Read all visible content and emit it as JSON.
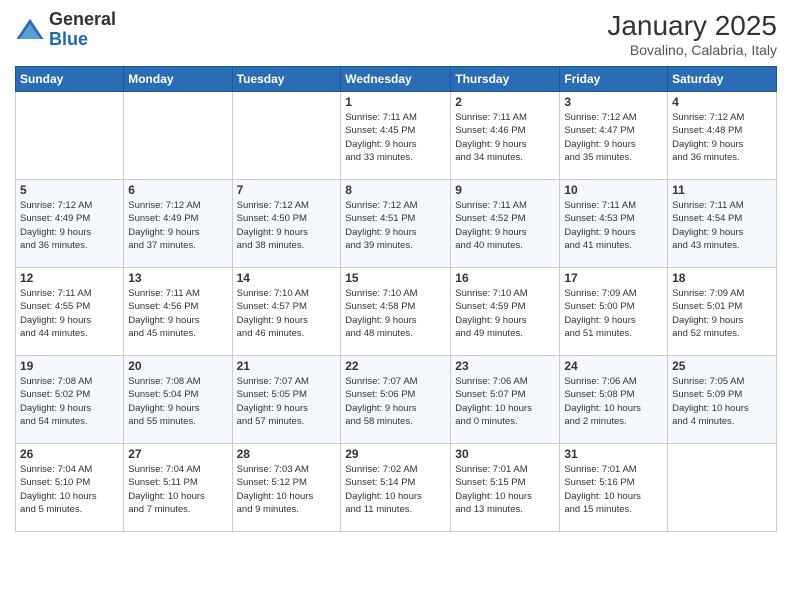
{
  "logo": {
    "general": "General",
    "blue": "Blue"
  },
  "header": {
    "month_year": "January 2025",
    "location": "Bovalino, Calabria, Italy"
  },
  "weekdays": [
    "Sunday",
    "Monday",
    "Tuesday",
    "Wednesday",
    "Thursday",
    "Friday",
    "Saturday"
  ],
  "weeks": [
    [
      {
        "day": "",
        "info": ""
      },
      {
        "day": "",
        "info": ""
      },
      {
        "day": "",
        "info": ""
      },
      {
        "day": "1",
        "info": "Sunrise: 7:11 AM\nSunset: 4:45 PM\nDaylight: 9 hours\nand 33 minutes."
      },
      {
        "day": "2",
        "info": "Sunrise: 7:11 AM\nSunset: 4:46 PM\nDaylight: 9 hours\nand 34 minutes."
      },
      {
        "day": "3",
        "info": "Sunrise: 7:12 AM\nSunset: 4:47 PM\nDaylight: 9 hours\nand 35 minutes."
      },
      {
        "day": "4",
        "info": "Sunrise: 7:12 AM\nSunset: 4:48 PM\nDaylight: 9 hours\nand 36 minutes."
      }
    ],
    [
      {
        "day": "5",
        "info": "Sunrise: 7:12 AM\nSunset: 4:49 PM\nDaylight: 9 hours\nand 36 minutes."
      },
      {
        "day": "6",
        "info": "Sunrise: 7:12 AM\nSunset: 4:49 PM\nDaylight: 9 hours\nand 37 minutes."
      },
      {
        "day": "7",
        "info": "Sunrise: 7:12 AM\nSunset: 4:50 PM\nDaylight: 9 hours\nand 38 minutes."
      },
      {
        "day": "8",
        "info": "Sunrise: 7:12 AM\nSunset: 4:51 PM\nDaylight: 9 hours\nand 39 minutes."
      },
      {
        "day": "9",
        "info": "Sunrise: 7:11 AM\nSunset: 4:52 PM\nDaylight: 9 hours\nand 40 minutes."
      },
      {
        "day": "10",
        "info": "Sunrise: 7:11 AM\nSunset: 4:53 PM\nDaylight: 9 hours\nand 41 minutes."
      },
      {
        "day": "11",
        "info": "Sunrise: 7:11 AM\nSunset: 4:54 PM\nDaylight: 9 hours\nand 43 minutes."
      }
    ],
    [
      {
        "day": "12",
        "info": "Sunrise: 7:11 AM\nSunset: 4:55 PM\nDaylight: 9 hours\nand 44 minutes."
      },
      {
        "day": "13",
        "info": "Sunrise: 7:11 AM\nSunset: 4:56 PM\nDaylight: 9 hours\nand 45 minutes."
      },
      {
        "day": "14",
        "info": "Sunrise: 7:10 AM\nSunset: 4:57 PM\nDaylight: 9 hours\nand 46 minutes."
      },
      {
        "day": "15",
        "info": "Sunrise: 7:10 AM\nSunset: 4:58 PM\nDaylight: 9 hours\nand 48 minutes."
      },
      {
        "day": "16",
        "info": "Sunrise: 7:10 AM\nSunset: 4:59 PM\nDaylight: 9 hours\nand 49 minutes."
      },
      {
        "day": "17",
        "info": "Sunrise: 7:09 AM\nSunset: 5:00 PM\nDaylight: 9 hours\nand 51 minutes."
      },
      {
        "day": "18",
        "info": "Sunrise: 7:09 AM\nSunset: 5:01 PM\nDaylight: 9 hours\nand 52 minutes."
      }
    ],
    [
      {
        "day": "19",
        "info": "Sunrise: 7:08 AM\nSunset: 5:02 PM\nDaylight: 9 hours\nand 54 minutes."
      },
      {
        "day": "20",
        "info": "Sunrise: 7:08 AM\nSunset: 5:04 PM\nDaylight: 9 hours\nand 55 minutes."
      },
      {
        "day": "21",
        "info": "Sunrise: 7:07 AM\nSunset: 5:05 PM\nDaylight: 9 hours\nand 57 minutes."
      },
      {
        "day": "22",
        "info": "Sunrise: 7:07 AM\nSunset: 5:06 PM\nDaylight: 9 hours\nand 58 minutes."
      },
      {
        "day": "23",
        "info": "Sunrise: 7:06 AM\nSunset: 5:07 PM\nDaylight: 10 hours\nand 0 minutes."
      },
      {
        "day": "24",
        "info": "Sunrise: 7:06 AM\nSunset: 5:08 PM\nDaylight: 10 hours\nand 2 minutes."
      },
      {
        "day": "25",
        "info": "Sunrise: 7:05 AM\nSunset: 5:09 PM\nDaylight: 10 hours\nand 4 minutes."
      }
    ],
    [
      {
        "day": "26",
        "info": "Sunrise: 7:04 AM\nSunset: 5:10 PM\nDaylight: 10 hours\nand 5 minutes."
      },
      {
        "day": "27",
        "info": "Sunrise: 7:04 AM\nSunset: 5:11 PM\nDaylight: 10 hours\nand 7 minutes."
      },
      {
        "day": "28",
        "info": "Sunrise: 7:03 AM\nSunset: 5:12 PM\nDaylight: 10 hours\nand 9 minutes."
      },
      {
        "day": "29",
        "info": "Sunrise: 7:02 AM\nSunset: 5:14 PM\nDaylight: 10 hours\nand 11 minutes."
      },
      {
        "day": "30",
        "info": "Sunrise: 7:01 AM\nSunset: 5:15 PM\nDaylight: 10 hours\nand 13 minutes."
      },
      {
        "day": "31",
        "info": "Sunrise: 7:01 AM\nSunset: 5:16 PM\nDaylight: 10 hours\nand 15 minutes."
      },
      {
        "day": "",
        "info": ""
      }
    ]
  ]
}
